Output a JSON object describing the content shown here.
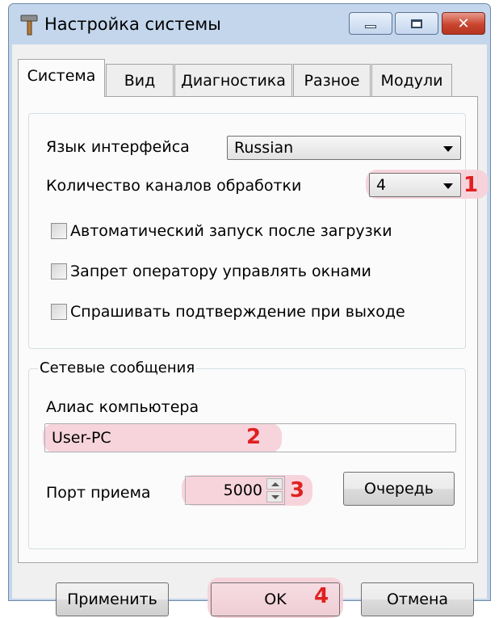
{
  "window": {
    "title": "Настройка системы",
    "app_icon": "hammer-icon"
  },
  "tabs": [
    "Система",
    "Вид",
    "Диагностика",
    "Разное",
    "Модули"
  ],
  "system": {
    "language_label": "Язык интерфейса",
    "language_value": "Russian",
    "channels_label": "Количество каналов обработки",
    "channels_value": "4",
    "checkboxes": [
      {
        "label": "Автоматический запуск после загрузки",
        "checked": false
      },
      {
        "label": "Запрет оператору управлять окнами",
        "checked": false
      },
      {
        "label": "Спрашивать подтверждение при выходе",
        "checked": false
      }
    ]
  },
  "network": {
    "legend": "Сетевые сообщения",
    "alias_label": "Алиас компьютера",
    "alias_value": "User-PC",
    "port_label": "Порт приема",
    "port_value": "5000",
    "queue_button": "Очередь"
  },
  "buttons": {
    "apply": "Применить",
    "ok": "OK",
    "cancel": "Отмена"
  },
  "annotations": [
    "1",
    "2",
    "3",
    "4"
  ],
  "colors": {
    "annotation": "#e02020",
    "highlight": "#f6cfd8",
    "title_bar": "#c3d6ec",
    "close_button": "#c9452f"
  }
}
